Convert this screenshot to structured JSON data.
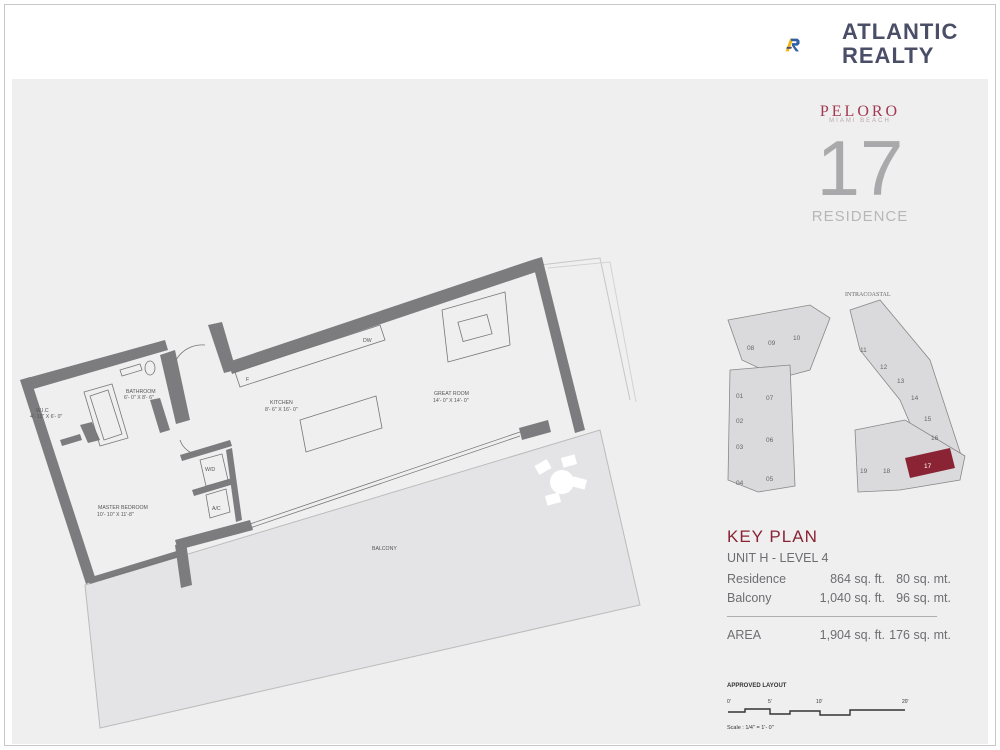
{
  "brand": {
    "name_line1": "ATLANTIC",
    "name_line2": "REALTY",
    "colors": {
      "yellow": "#f2b516",
      "blue": "#2f5fa6",
      "gray": "#4a4e66"
    }
  },
  "project": {
    "name": "PELORO",
    "location": "MIAMI BEACH",
    "unit_number": "17",
    "unit_word": "RESIDENCE",
    "accent_color": "#8a2333"
  },
  "plan_labels": {
    "wic": "W.I.C",
    "wic_dim": "4'- 11\" X 6'- 0\"",
    "bathroom": "BATHROOM",
    "bathroom_dim": "6'- 0\" X 8'- 6\"",
    "kitchen": "KITCHEN",
    "kitchen_dim": "8'- 6\" X 16'- 0\"",
    "great_room": "GREAT ROOM",
    "great_room_dim": "14'- 0\" X 14'- 0\"",
    "master_bedroom": "MASTER BEDROOM",
    "master_bedroom_dim": "10'- 10\" X 11'-8\"",
    "balcony": "BALCONY",
    "wd": "W/D",
    "ac": "A/C",
    "dw": "DW",
    "f": "F"
  },
  "key_map": {
    "water_label": "INTRACOASTAL",
    "units_west": [
      "08",
      "09",
      "10",
      "01",
      "02",
      "03",
      "04",
      "05",
      "06",
      "07"
    ],
    "units_east": [
      "11",
      "12",
      "13",
      "14",
      "15",
      "16",
      "17",
      "18",
      "19"
    ],
    "highlighted_unit": "17"
  },
  "key_plan": {
    "title": "KEY PLAN",
    "unit_level": "UNIT H -  LEVEL 4",
    "rows": [
      {
        "label": "Residence",
        "sqft": "864 sq. ft.",
        "sqm": "80 sq. mt."
      },
      {
        "label": "Balcony",
        "sqft": "1,040 sq. ft.",
        "sqm": "96 sq. mt."
      }
    ],
    "total": {
      "label": "AREA",
      "sqft": "1,904 sq. ft.",
      "sqm": "176 sq. mt."
    }
  },
  "scale_bar": {
    "approved_label": "APPROVED LAYOUT",
    "ticks": [
      "0'",
      "5'",
      "10'",
      "20'"
    ],
    "scale_text": "Scale : 1/4\" = 1'- 0\""
  }
}
